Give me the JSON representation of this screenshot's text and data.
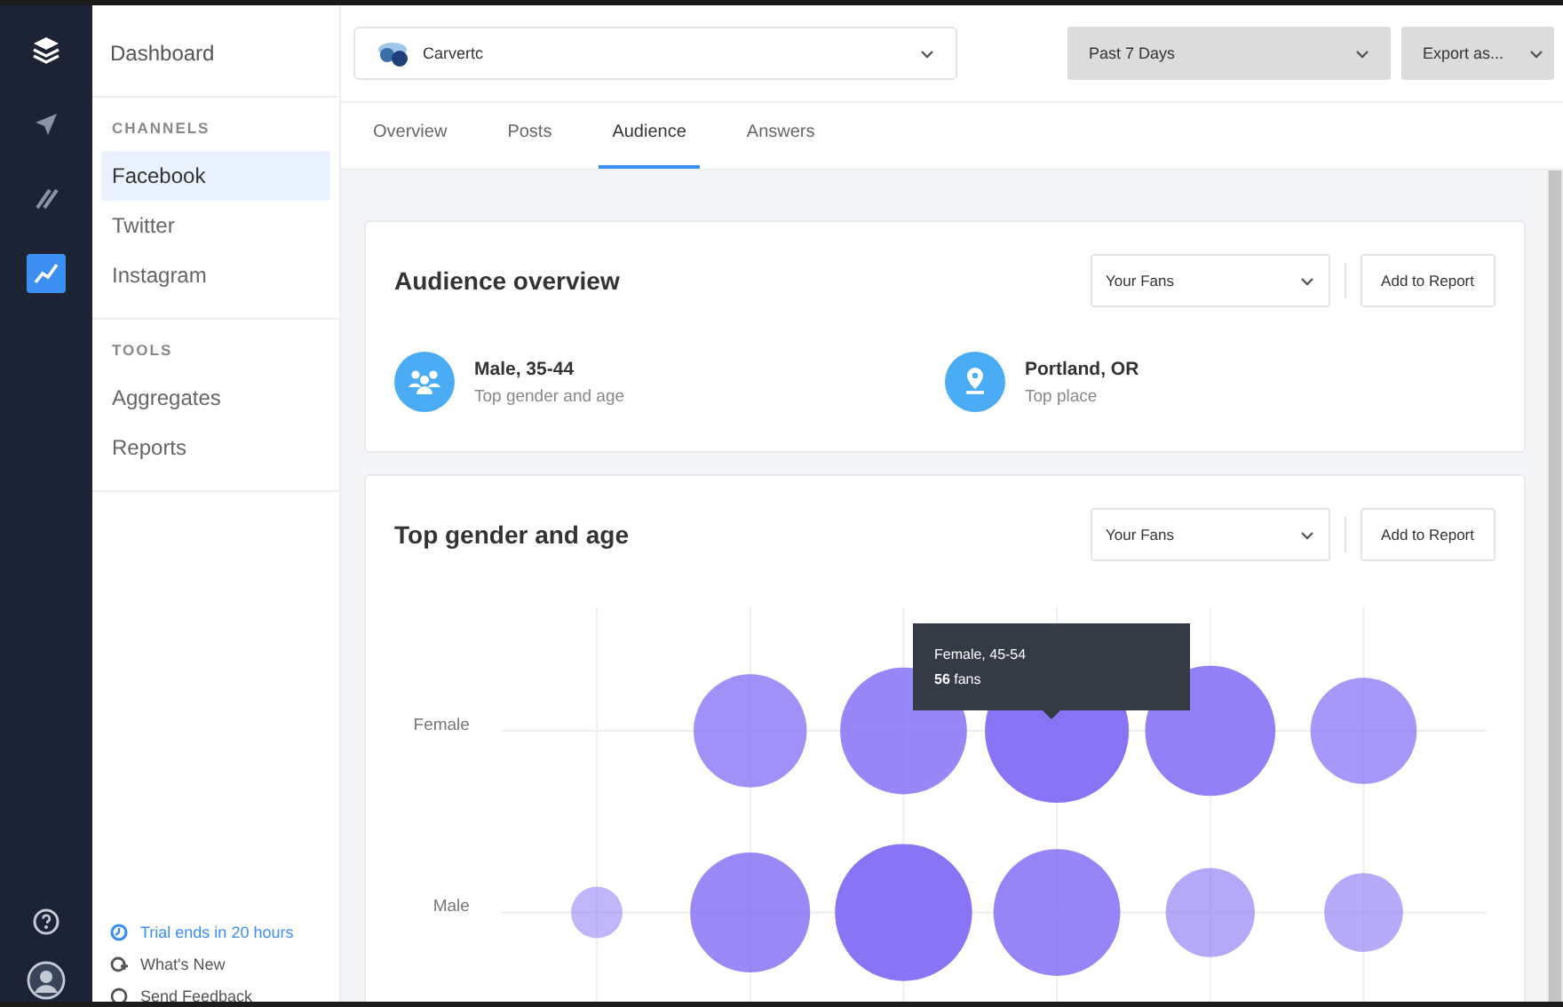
{
  "rail": [
    {
      "kind": "logo",
      "selected": false
    },
    {
      "kind": "send",
      "selected": false
    },
    {
      "kind": "compose",
      "selected": false
    },
    {
      "kind": "analytics",
      "selected": true
    }
  ],
  "rail_bottom": [
    {
      "kind": "help"
    },
    {
      "kind": "avatar"
    }
  ],
  "sidebar": {
    "title": "Dashboard",
    "sections": [
      {
        "heading": "CHANNELS",
        "items": [
          {
            "label": "Facebook",
            "selected": true
          },
          {
            "label": "Twitter",
            "selected": false
          },
          {
            "label": "Instagram",
            "selected": false
          }
        ]
      },
      {
        "heading": "TOOLS",
        "items": [
          {
            "label": "Aggregates",
            "selected": false
          },
          {
            "label": "Reports",
            "selected": false
          }
        ]
      }
    ],
    "footer_links": [
      {
        "kind": "trial",
        "label": "Trial ends in 20 hours"
      },
      {
        "kind": "news",
        "label": "What's New"
      },
      {
        "kind": "feedback",
        "label": "Send Feedback"
      }
    ]
  },
  "topbar": {
    "account": "Carvertc",
    "period": "Past 7 Days",
    "export": "Export as..."
  },
  "tabs": [
    {
      "label": "Overview",
      "selected": false
    },
    {
      "label": "Posts",
      "selected": false
    },
    {
      "label": "Audience",
      "selected": true
    },
    {
      "label": "Answers",
      "selected": false
    }
  ],
  "overview": {
    "title": "Audience overview",
    "filter": "Your Fans",
    "action": "Add to Report",
    "stats": [
      {
        "kind": "people",
        "value": "Male, 35-44",
        "caption": "Top gender and age"
      },
      {
        "kind": "place",
        "value": "Portland, OR",
        "caption": "Top place"
      }
    ]
  },
  "gender_age": {
    "title": "Top gender and age",
    "filter": "Your Fans",
    "action": "Add to Report",
    "rows": [
      "Female",
      "Male"
    ],
    "tooltip": {
      "title": "Female, 45-54",
      "text": "**56** fans"
    }
  }
}
